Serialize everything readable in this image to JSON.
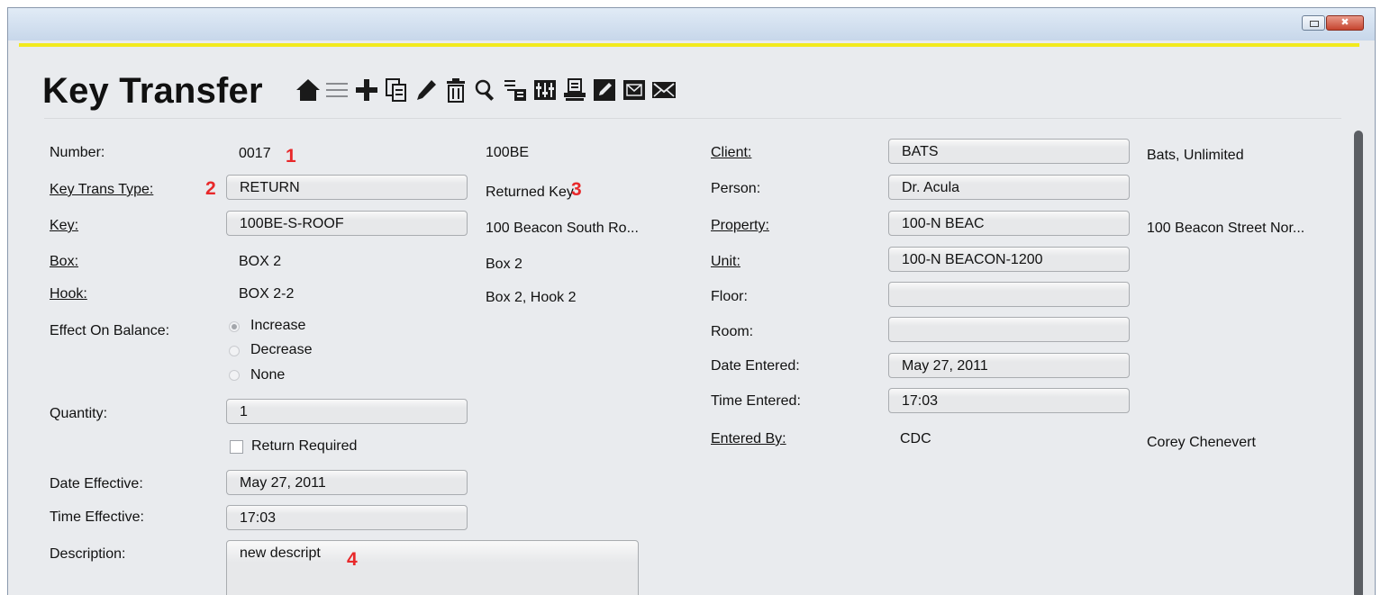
{
  "window": {
    "title": "Key Transfer"
  },
  "toolbar": {
    "icons": [
      "home-icon",
      "list-icon",
      "add-icon",
      "copy-icon",
      "edit-icon",
      "delete-icon",
      "search-icon",
      "tree-icon",
      "columns-icon",
      "print-icon",
      "notepad-icon",
      "email-box-icon",
      "envelope-icon"
    ]
  },
  "left": {
    "number_label": "Number:",
    "number_value": "0017",
    "number_code": "100BE",
    "key_trans_type_label": "Key Trans Type:",
    "key_trans_type_value": "RETURN",
    "key_trans_type_desc": "Returned Key",
    "key_label": "Key:",
    "key_value": "100BE-S-ROOF",
    "key_desc": "100 Beacon South Ro...",
    "box_label": "Box:",
    "box_value": "BOX 2",
    "box_desc": "Box 2",
    "hook_label": "Hook:",
    "hook_value": "BOX 2-2",
    "hook_desc": "Box 2, Hook 2",
    "effect_label": "Effect On Balance:",
    "effect_options": [
      "Increase",
      "Decrease",
      "None"
    ],
    "effect_selected": "Increase",
    "quantity_label": "Quantity:",
    "quantity_value": "1",
    "return_required_label": "Return Required",
    "return_required_checked": false,
    "date_effective_label": "Date Effective:",
    "date_effective_value": "May 27, 2011",
    "time_effective_label": "Time Effective:",
    "time_effective_value": "17:03",
    "description_label": "Description:",
    "description_value": "new descript"
  },
  "right": {
    "client_label": "Client:",
    "client_value": "BATS",
    "client_desc": "Bats, Unlimited",
    "person_label": "Person:",
    "person_value": "Dr. Acula",
    "property_label": "Property:",
    "property_value": "100-N BEAC",
    "property_desc": "100 Beacon Street Nor...",
    "unit_label": "Unit:",
    "unit_value": "100-N BEACON-1200",
    "floor_label": "Floor:",
    "floor_value": "",
    "room_label": "Room:",
    "room_value": "",
    "date_entered_label": "Date Entered:",
    "date_entered_value": "May 27, 2011",
    "time_entered_label": "Time Entered:",
    "time_entered_value": "17:03",
    "entered_by_label": "Entered By:",
    "entered_by_value": "CDC",
    "entered_by_desc": "Corey Chenevert"
  },
  "annotations": [
    "1",
    "2",
    "3",
    "4"
  ],
  "colors": {
    "accent": "#f2ea1e",
    "annotation": "#e8282a",
    "background": "#e9ebee"
  }
}
